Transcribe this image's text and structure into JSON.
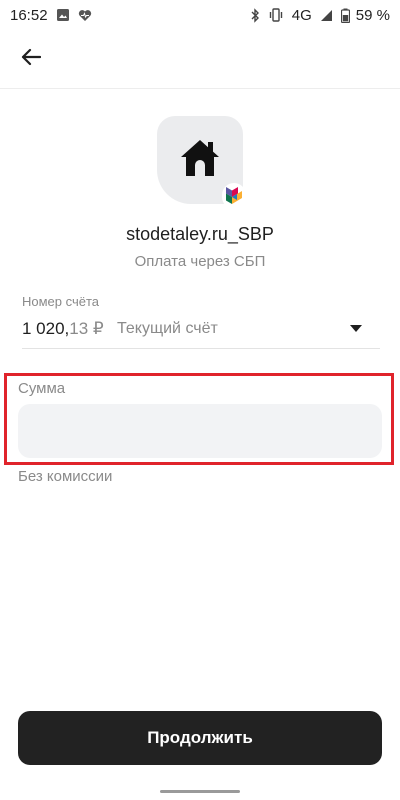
{
  "status_bar": {
    "time": "16:52",
    "network": "4G",
    "battery": "59 %",
    "icons": [
      "image-icon",
      "health-icon",
      "bluetooth-icon",
      "vibrate-icon",
      "signal-icon",
      "battery-icon"
    ]
  },
  "app_bar": {
    "back_icon": "back-arrow-icon"
  },
  "merchant": {
    "logo_icon": "house-icon",
    "badge_icon": "sbp-icon",
    "name": "stodetaley.ru_SBP",
    "subtitle": "Оплата через СБП"
  },
  "account": {
    "label": "Номер счёта",
    "amount_main": "1 020,",
    "amount_decimals": "13 ₽",
    "name": "Текущий счёт"
  },
  "amount": {
    "label": "Сумма",
    "value": "",
    "commission": "Без комиссии"
  },
  "actions": {
    "continue_label": "Продолжить"
  },
  "colors": {
    "accent_dark": "#222222",
    "highlight_red": "#e0232b",
    "input_bg": "#f2f3f5",
    "muted_text": "#8a8a8a"
  }
}
